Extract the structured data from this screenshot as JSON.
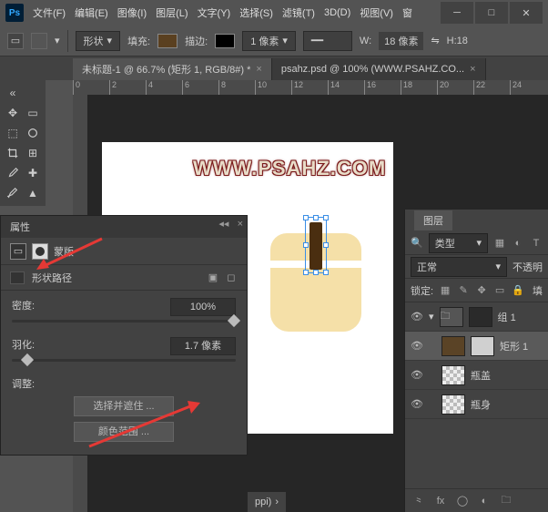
{
  "menu": {
    "items": [
      "文件(F)",
      "编辑(E)",
      "图像(I)",
      "图层(L)",
      "文字(Y)",
      "选择(S)",
      "滤镜(T)",
      "3D(D)",
      "视图(V)",
      "窗"
    ]
  },
  "options": {
    "shape": "形状",
    "fill": "填充:",
    "stroke": "描边:",
    "strokeSize": "1 像素",
    "wLabel": "W:",
    "wVal": "18 像素",
    "hLabel": "H:18"
  },
  "tabs": [
    {
      "label": "未标题-1 @ 66.7% (矩形 1, RGB/8#) *"
    },
    {
      "label": "psahz.psd @ 100% (WWW.PSAHZ.CO..."
    }
  ],
  "ruler": {
    "marks": [
      "0",
      "2",
      "4",
      "6",
      "8",
      "10",
      "12",
      "14",
      "16",
      "18",
      "20",
      "22",
      "24"
    ]
  },
  "watermark": "WWW.PSAHZ.COM",
  "props": {
    "tab": "属性",
    "mask": "蒙版",
    "pathLabel": "形状路径",
    "density": "密度:",
    "densityVal": "100%",
    "feather": "羽化:",
    "featherVal": "1.7 像素",
    "adjust": "调整:",
    "selectMask": "选择并遮住 ...",
    "colorRange": "颜色范围 ..."
  },
  "layers": {
    "tab": "图层",
    "kind": "类型",
    "mode": "正常",
    "opacity": "不透明",
    "lock": "锁定:",
    "fill": "填",
    "items": [
      {
        "name": "组 1",
        "type": "folder"
      },
      {
        "name": "矩形 1",
        "type": "shape",
        "selected": true
      },
      {
        "name": "瓶盖",
        "type": "bitmap"
      },
      {
        "name": "瓶身",
        "type": "bitmap"
      }
    ]
  },
  "status": "ppi)",
  "logo": "Ps"
}
